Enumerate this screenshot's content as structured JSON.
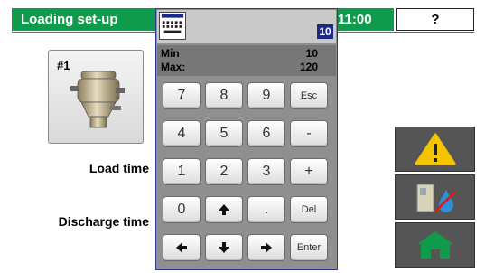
{
  "header": {
    "title": "Loading set-up",
    "time": "11:00",
    "help": "?"
  },
  "unit": {
    "label": "#1"
  },
  "labels": {
    "load_time": "Load time",
    "discharge_time": "Discharge time"
  },
  "keypad": {
    "current_value": "10",
    "min_label": "Min",
    "min_value": "10",
    "max_label": "Max:",
    "max_value": "120",
    "keys": {
      "k7": "7",
      "k8": "8",
      "k9": "9",
      "esc": "Esc",
      "k4": "4",
      "k5": "5",
      "k6": "6",
      "minus": "-",
      "k1": "1",
      "k2": "2",
      "k3": "3",
      "plus": "+",
      "k0": "0",
      "dot": ".",
      "del": "Del",
      "enter": "Enter"
    }
  },
  "colors": {
    "header_green": "#0f9a4c",
    "warning_yellow": "#f5c400",
    "home_green": "#0f9a4c",
    "value_badge": "#1b2a86"
  },
  "icons": {
    "keyboard": "keyboard-icon",
    "up": "arrow-up-icon",
    "down": "arrow-down-icon",
    "left": "arrow-left-icon",
    "right": "arrow-right-icon",
    "warning": "warning-icon",
    "dryer_water": "dryer-water-off-icon",
    "home": "home-icon"
  }
}
